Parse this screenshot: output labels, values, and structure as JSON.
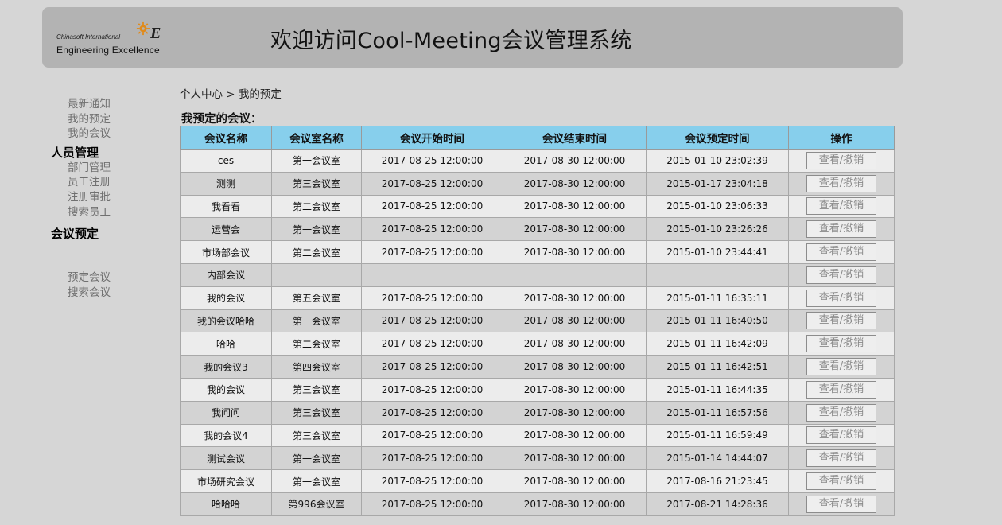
{
  "header": {
    "logo_small": "Chinasoft International",
    "logo_big": "Engineering Excellence",
    "logo_mark": "E",
    "title": "欢迎访问Cool-Meeting会议管理系统"
  },
  "sidebar": {
    "personal_items": [
      "最新通知",
      "我的预定",
      "我的会议"
    ],
    "staff_heading": "人员管理",
    "staff_items": [
      "部门管理",
      "员工注册",
      "注册审批",
      "搜索员工"
    ],
    "meeting_heading": "会议预定",
    "meeting_items": [
      "预定会议",
      "搜索会议"
    ]
  },
  "breadcrumb": "个人中心 > 我的预定",
  "section_title": "我预定的会议：",
  "table": {
    "headers": [
      "会议名称",
      "会议室名称",
      "会议开始时间",
      "会议结束时间",
      "会议预定时间",
      "操作"
    ],
    "action_label": "查看/撤销",
    "rows": [
      [
        "ces",
        "第一会议室",
        "2017-08-25 12:00:00",
        "2017-08-30 12:00:00",
        "2015-01-10 23:02:39"
      ],
      [
        "测测",
        "第三会议室",
        "2017-08-25 12:00:00",
        "2017-08-30 12:00:00",
        "2015-01-17 23:04:18"
      ],
      [
        "我看看",
        "第二会议室",
        "2017-08-25 12:00:00",
        "2017-08-30 12:00:00",
        "2015-01-10 23:06:33"
      ],
      [
        "运营会",
        "第一会议室",
        "2017-08-25 12:00:00",
        "2017-08-30 12:00:00",
        "2015-01-10 23:26:26"
      ],
      [
        "市场部会议",
        "第二会议室",
        "2017-08-25 12:00:00",
        "2017-08-30 12:00:00",
        "2015-01-10 23:44:41"
      ],
      [
        "内部会议",
        "",
        "",
        "",
        ""
      ],
      [
        "我的会议",
        "第五会议室",
        "2017-08-25 12:00:00",
        "2017-08-30 12:00:00",
        "2015-01-11 16:35:11"
      ],
      [
        "我的会议哈哈",
        "第一会议室",
        "2017-08-25 12:00:00",
        "2017-08-30 12:00:00",
        "2015-01-11 16:40:50"
      ],
      [
        "哈哈",
        "第二会议室",
        "2017-08-25 12:00:00",
        "2017-08-30 12:00:00",
        "2015-01-11 16:42:09"
      ],
      [
        "我的会议3",
        "第四会议室",
        "2017-08-25 12:00:00",
        "2017-08-30 12:00:00",
        "2015-01-11 16:42:51"
      ],
      [
        "我的会议",
        "第三会议室",
        "2017-08-25 12:00:00",
        "2017-08-30 12:00:00",
        "2015-01-11 16:44:35"
      ],
      [
        "我问问",
        "第三会议室",
        "2017-08-25 12:00:00",
        "2017-08-30 12:00:00",
        "2015-01-11 16:57:56"
      ],
      [
        "我的会议4",
        "第三会议室",
        "2017-08-25 12:00:00",
        "2017-08-30 12:00:00",
        "2015-01-11 16:59:49"
      ],
      [
        "测试会议",
        "第一会议室",
        "2017-08-25 12:00:00",
        "2017-08-30 12:00:00",
        "2015-01-14 14:44:07"
      ],
      [
        "市场研究会议",
        "第一会议室",
        "2017-08-25 12:00:00",
        "2017-08-30 12:00:00",
        "2017-08-16 21:23:45"
      ],
      [
        "哈哈哈",
        "第996会议室",
        "2017-08-25 12:00:00",
        "2017-08-30 12:00:00",
        "2017-08-21 14:28:36"
      ]
    ]
  },
  "colors": {
    "page_bg": "#d6d6d6",
    "header_bg": "#b3b3b3",
    "table_header_bg": "#87cfec",
    "row_light": "#ececec",
    "row_dark": "#d3d3d3",
    "nav_muted": "#707070"
  },
  "icons": {
    "logo": "gear-logo-icon"
  }
}
